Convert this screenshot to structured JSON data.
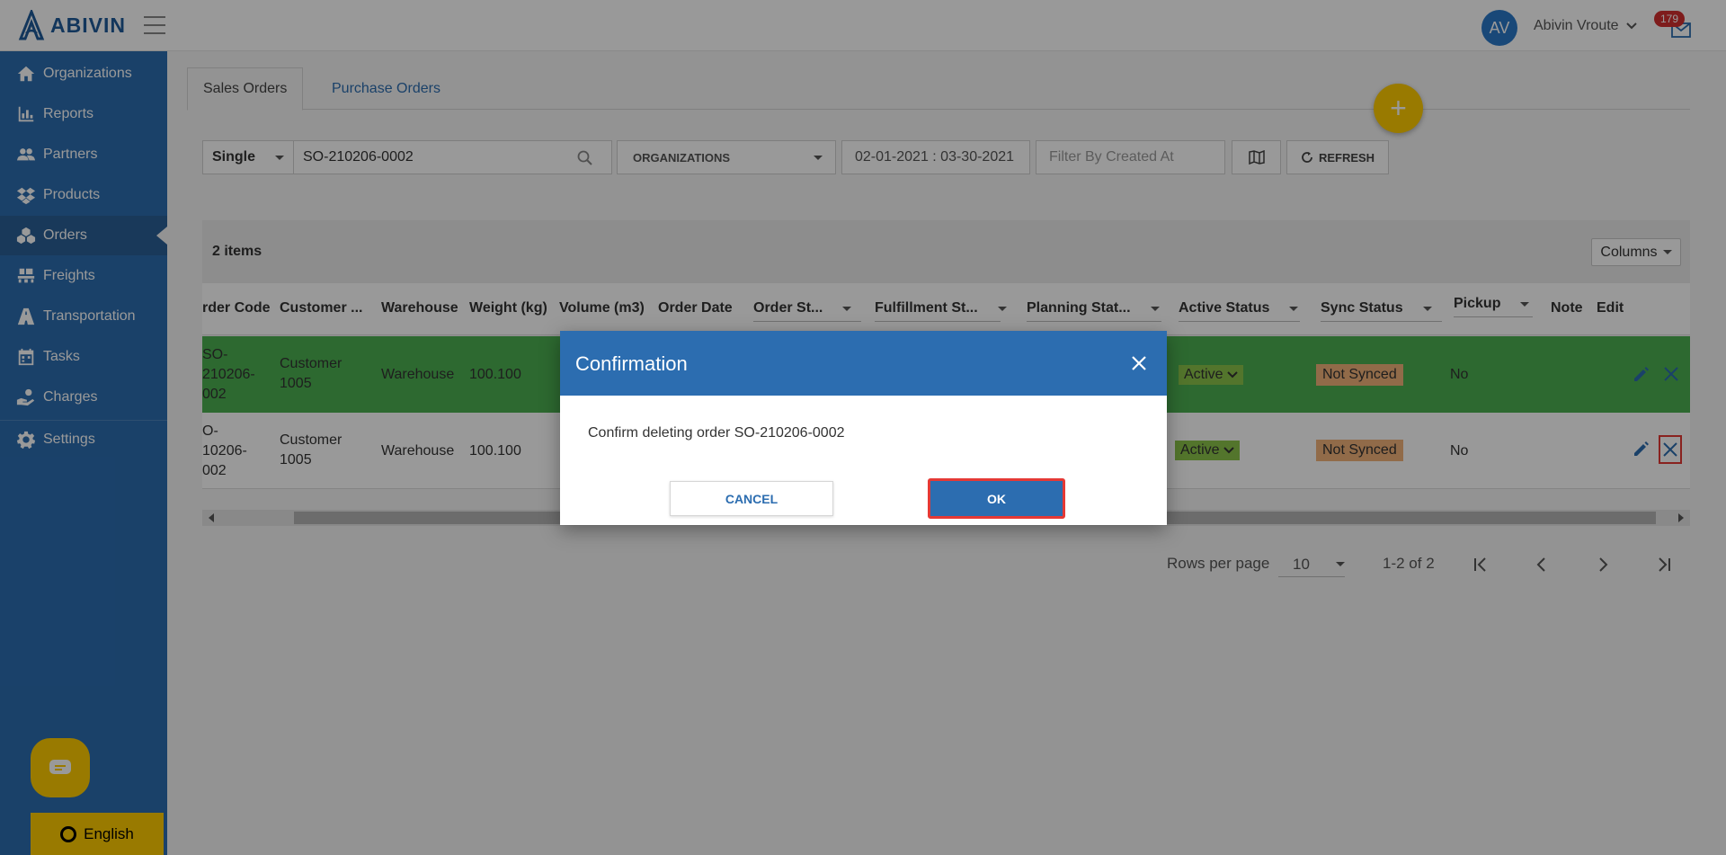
{
  "header": {
    "brand": "ABIVIN",
    "avatar_initials": "AV",
    "user_name": "Abivin Vroute",
    "notification_count": "179"
  },
  "sidebar": {
    "items": [
      {
        "label": "Organizations",
        "icon": "home-icon"
      },
      {
        "label": "Reports",
        "icon": "bar-chart-icon"
      },
      {
        "label": "Partners",
        "icon": "users-icon"
      },
      {
        "label": "Products",
        "icon": "dropbox-icon"
      },
      {
        "label": "Orders",
        "icon": "cubes-icon",
        "active": true
      },
      {
        "label": "Freights",
        "icon": "pallet-icon"
      },
      {
        "label": "Transportation",
        "icon": "road-icon"
      },
      {
        "label": "Tasks",
        "icon": "calendar-icon"
      },
      {
        "label": "Charges",
        "icon": "hand-coin-icon"
      },
      {
        "label": "Settings",
        "icon": "gear-icon"
      }
    ],
    "language": "English"
  },
  "tabs": [
    "Sales Orders",
    "Purchase Orders"
  ],
  "filters": {
    "mode": "Single",
    "search_value": "SO-210206-0002",
    "organizations": "ORGANIZATIONS",
    "date_range": "02-01-2021 : 03-30-2021",
    "created_at_placeholder": "Filter By Created At",
    "refresh_label": "REFRESH"
  },
  "table": {
    "items_count": "2 items",
    "columns_button": "Columns",
    "headers": [
      "rder Code",
      "Customer ...",
      "Warehouse",
      "Weight (kg)",
      "Volume (m3)",
      "Order Date",
      "Order St...",
      "Fulfillment St...",
      "Planning Stat...",
      "Active Status",
      "Sync Status",
      "Pickup",
      "Note",
      "Edit"
    ],
    "rows": [
      {
        "code": "SO-\n210206-\n0002",
        "code_visible": [
          "SO-",
          "210206-",
          "002"
        ],
        "customer": [
          "Customer",
          "1005"
        ],
        "warehouse": "Warehouse",
        "weight": "100.100",
        "active": "Active",
        "sync": "Not Synced",
        "pickup": "No"
      },
      {
        "code_visible": [
          "O-",
          "10206-",
          "002"
        ],
        "customer": [
          "Customer",
          "1005"
        ],
        "warehouse": "Warehouse",
        "weight": "100.100",
        "active": "Active",
        "sync": "Not Synced",
        "pickup": "No"
      }
    ]
  },
  "pagination": {
    "rows_per_page_label": "Rows per page",
    "rows_per_page_value": "10",
    "range": "1-2 of 2"
  },
  "dialog": {
    "title": "Confirmation",
    "message": "Confirm deleting order SO-210206-0002",
    "cancel": "CANCEL",
    "ok": "OK"
  },
  "colors": {
    "primary": "#2c6db0",
    "accent": "#ffcc00",
    "row_highlight": "#4caf50",
    "active_pill": "#8bc34a",
    "sync_pill": "#f2b27a",
    "focus_outline": "#e53935"
  }
}
